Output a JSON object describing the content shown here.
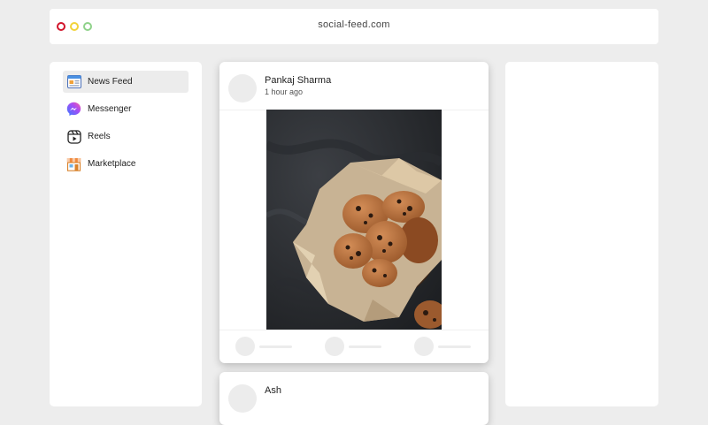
{
  "browser": {
    "url": "social-feed.com"
  },
  "sidebar": {
    "items": [
      {
        "label": "News Feed",
        "icon": "news-feed-icon",
        "active": true
      },
      {
        "label": "Messenger",
        "icon": "messenger-icon",
        "active": false
      },
      {
        "label": "Reels",
        "icon": "reels-icon",
        "active": false
      },
      {
        "label": "Marketplace",
        "icon": "marketplace-icon",
        "active": false
      }
    ]
  },
  "posts": [
    {
      "author": "Pankaj Sharma",
      "time": "1 hour ago",
      "image": "chocolate-chip-cookies-photo"
    },
    {
      "author": "Ash"
    }
  ],
  "colors": {
    "background": "#ededed",
    "card": "#ffffff",
    "dot_red": "#d2152b",
    "dot_yellow": "#f2d33a",
    "dot_green": "#8fd28a",
    "messenger_gradient_start": "#3a7bff",
    "messenger_gradient_end": "#ff5ba0"
  }
}
